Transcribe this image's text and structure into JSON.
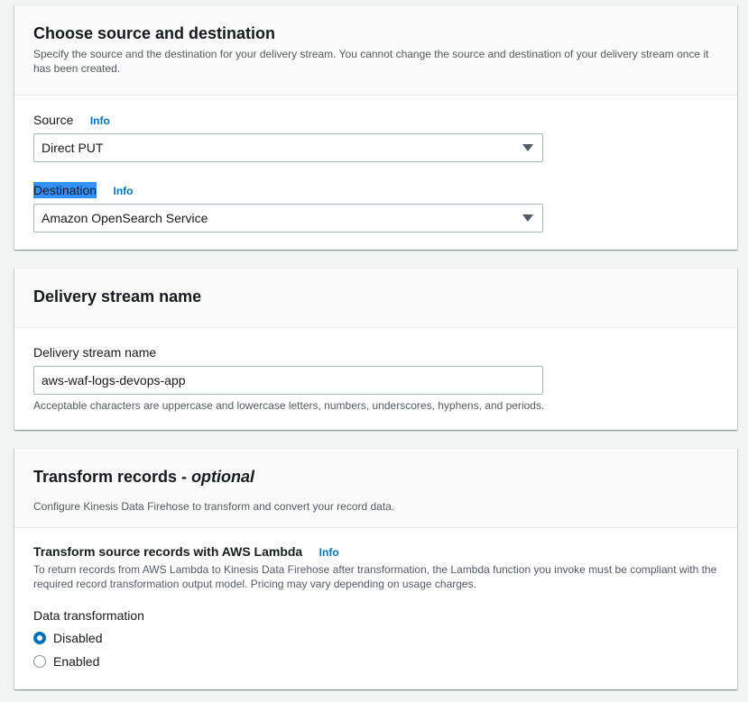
{
  "source_dest": {
    "title": "Choose source and destination",
    "description": "Specify the source and the destination for your delivery stream. You cannot change the source and destination of your delivery stream once it has been created.",
    "source_label": "Source",
    "source_info": "Info",
    "source_value": "Direct PUT",
    "destination_label": "Destination",
    "destination_info": "Info",
    "destination_value": "Amazon OpenSearch Service"
  },
  "stream_name": {
    "title": "Delivery stream name",
    "field_label": "Delivery stream name",
    "value": "aws-waf-logs-devops-app",
    "hint": "Acceptable characters are uppercase and lowercase letters, numbers, underscores, hyphens, and periods."
  },
  "transform": {
    "title": "Transform records - ",
    "title_optional": "optional",
    "description": "Configure Kinesis Data Firehose to transform and convert your record data.",
    "lambda_title": "Transform source records with AWS Lambda",
    "lambda_info": "Info",
    "lambda_desc": "To return records from AWS Lambda to Kinesis Data Firehose after transformation, the Lambda function you invoke must be compliant with the required record transformation output model. Pricing may vary depending on usage charges.",
    "data_transformation_label": "Data transformation",
    "options": [
      "Disabled",
      "Enabled"
    ],
    "selected": "Disabled"
  },
  "colors": {
    "accent": "#0073bb",
    "highlight": "#3390ff"
  }
}
